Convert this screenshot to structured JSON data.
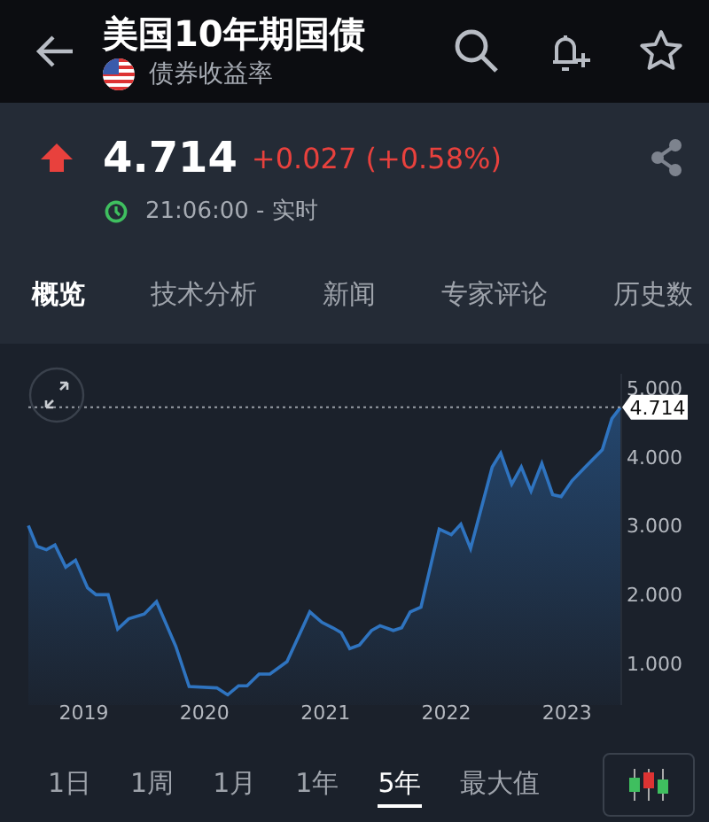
{
  "header": {
    "title": "美国10年期国债",
    "subtitle": "债券收益率"
  },
  "quote": {
    "value": "4.714",
    "change": "+0.027 (+0.58%)",
    "time": "21:06:00 - 实时"
  },
  "tabs": [
    {
      "label": "概览",
      "selected": true
    },
    {
      "label": "技术分析",
      "selected": false
    },
    {
      "label": "新闻",
      "selected": false
    },
    {
      "label": "专家评论",
      "selected": false
    },
    {
      "label": "历史数",
      "selected": false
    }
  ],
  "chart": {
    "chart_data": {
      "type": "area",
      "x": [
        2018.6,
        2018.67,
        2018.75,
        2018.82,
        2018.91,
        2018.99,
        2019.09,
        2019.16,
        2019.26,
        2019.34,
        2019.43,
        2019.56,
        2019.66,
        2019.82,
        2019.93,
        2020.16,
        2020.25,
        2020.34,
        2020.41,
        2020.51,
        2020.6,
        2020.74,
        2020.93,
        2021.03,
        2021.12,
        2021.19,
        2021.26,
        2021.34,
        2021.44,
        2021.51,
        2021.62,
        2021.69,
        2021.76,
        2021.85,
        2022.0,
        2022.1,
        2022.18,
        2022.26,
        2022.44,
        2022.51,
        2022.6,
        2022.68,
        2022.76,
        2022.85,
        2022.94,
        2023.01,
        2023.1,
        2023.21,
        2023.35,
        2023.43,
        2023.5
      ],
      "series": [
        {
          "color": "#2f74c0",
          "values": [
            3.0,
            2.7,
            2.65,
            2.72,
            2.4,
            2.5,
            2.1,
            2.0,
            2.0,
            1.5,
            1.65,
            1.72,
            1.9,
            1.25,
            0.67,
            0.65,
            0.55,
            0.68,
            0.68,
            0.85,
            0.85,
            1.03,
            1.75,
            1.6,
            1.52,
            1.45,
            1.22,
            1.27,
            1.48,
            1.55,
            1.48,
            1.52,
            1.75,
            1.82,
            2.95,
            2.87,
            3.02,
            2.67,
            3.85,
            4.05,
            3.6,
            3.85,
            3.5,
            3.9,
            3.45,
            3.42,
            3.65,
            3.85,
            4.1,
            4.55,
            4.71
          ]
        }
      ],
      "xlim": [
        2018.6,
        2023.5
      ],
      "ylim": [
        0.4,
        5.2
      ],
      "xticks": [
        {
          "value": 2019,
          "label": "2019"
        },
        {
          "value": 2020,
          "label": "2020"
        },
        {
          "value": 2021,
          "label": "2021"
        },
        {
          "value": 2022,
          "label": "2022"
        },
        {
          "value": 2023,
          "label": "2023"
        }
      ],
      "yticks": [
        {
          "value": 1,
          "label": "1.000"
        },
        {
          "value": 2,
          "label": "2.000"
        },
        {
          "value": 3,
          "label": "3.000"
        },
        {
          "value": 4,
          "label": "4.000"
        },
        {
          "value": 5,
          "label": "5.000"
        }
      ],
      "ref_lines": [
        {
          "axis": "y",
          "value": 4.714,
          "label": "4.714"
        }
      ]
    }
  },
  "ranges": [
    {
      "label": "1日",
      "selected": false
    },
    {
      "label": "1周",
      "selected": false
    },
    {
      "label": "1月",
      "selected": false
    },
    {
      "label": "1年",
      "selected": false
    },
    {
      "label": "5年",
      "selected": true
    },
    {
      "label": "最大值",
      "selected": false
    }
  ]
}
